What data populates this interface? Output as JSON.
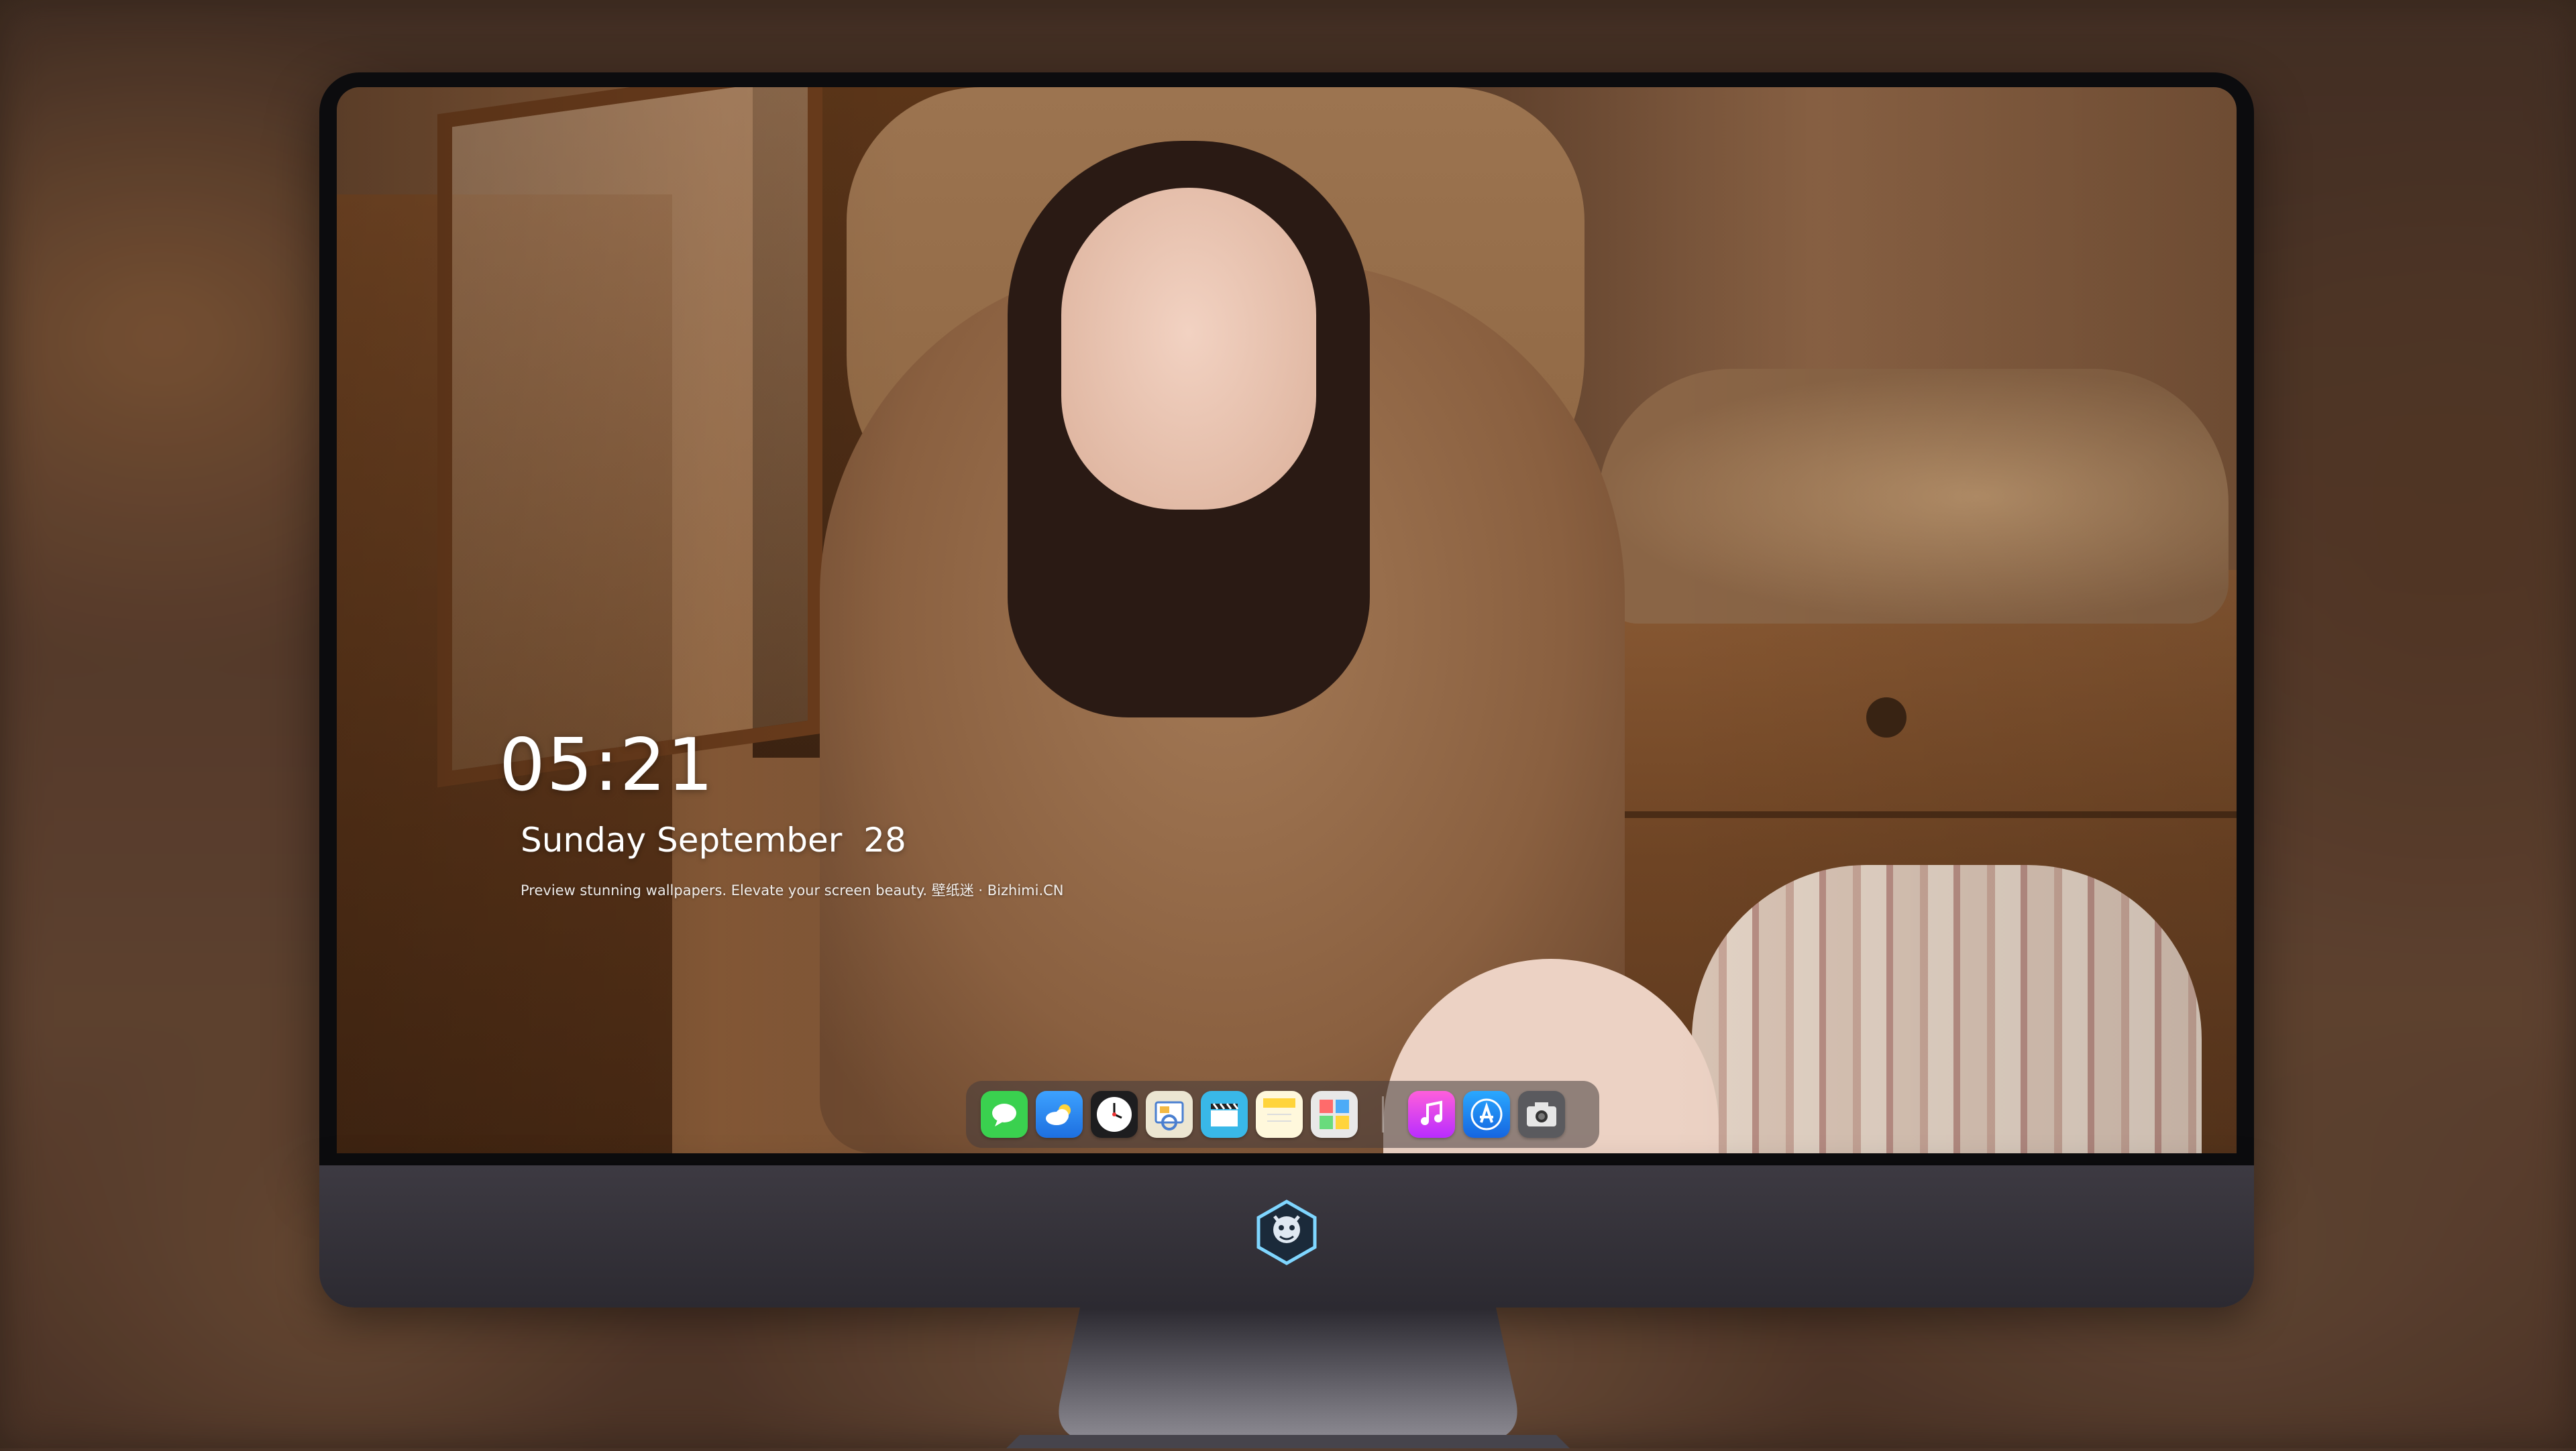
{
  "lockscreen": {
    "time": "05:21",
    "date": "Sunday September  28",
    "tagline": "Preview stunning wallpapers. Elevate your screen beauty. 壁纸迷 · Bizhimi.CN"
  },
  "dock": {
    "apps": [
      {
        "name": "messages",
        "icon": "speech-bubble",
        "color": "#3ad14f"
      },
      {
        "name": "weather",
        "icon": "cloud",
        "color": "#2f8ff0"
      },
      {
        "name": "clock",
        "icon": "clock-face",
        "color": "#1d1d1f"
      },
      {
        "name": "preview",
        "icon": "photo-viewer",
        "color": "#e8e0c8"
      },
      {
        "name": "clips",
        "icon": "clapperboard",
        "color": "#39b8e8"
      },
      {
        "name": "notes",
        "icon": "note-pad",
        "color": "#ffd43b"
      },
      {
        "name": "photo-booth",
        "icon": "photo-collage",
        "color": "#e8e8e8"
      },
      {
        "name": "music",
        "icon": "music-note",
        "color": "#e83ad6"
      },
      {
        "name": "app-store",
        "icon": "app-store-a",
        "color": "#1e90ff"
      },
      {
        "name": "camera",
        "icon": "camera",
        "color": "#5a5a5e"
      }
    ]
  },
  "chin": {
    "logo": "dragon-emblem-icon"
  }
}
